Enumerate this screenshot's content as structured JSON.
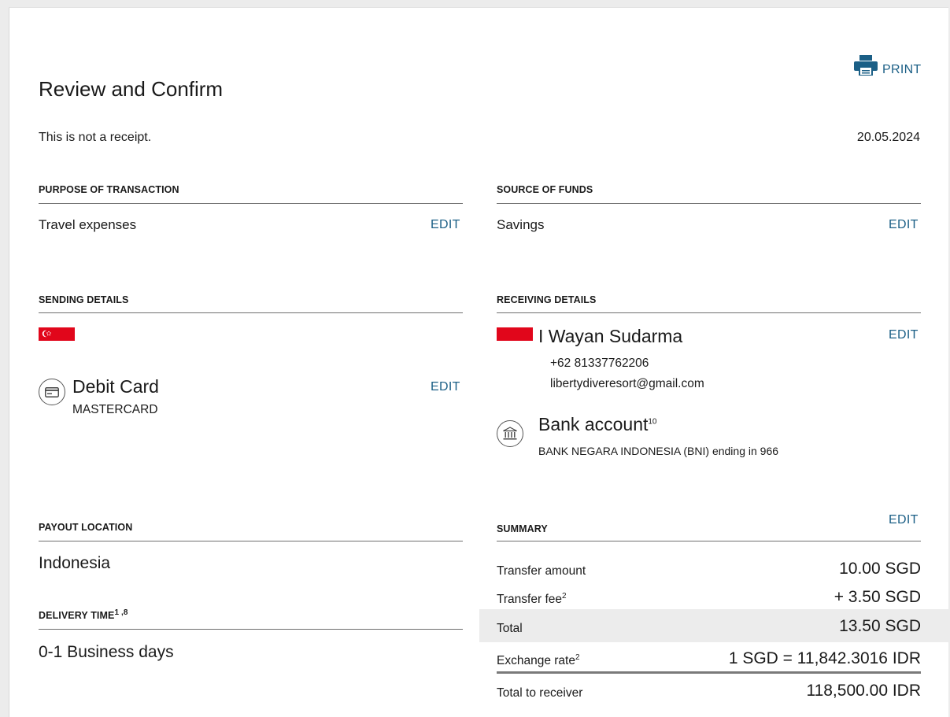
{
  "page": {
    "title": "Review and Confirm",
    "subtitle": "This is not a receipt.",
    "date": "20.05.2024",
    "print_label": "PRINT"
  },
  "purpose": {
    "heading": "PURPOSE OF TRANSACTION",
    "value": "Travel expenses",
    "edit_label": "EDIT"
  },
  "source": {
    "heading": "SOURCE OF FUNDS",
    "value": "Savings",
    "edit_label": "EDIT"
  },
  "sending": {
    "heading": "SENDING DETAILS",
    "flag": "singapore-flag-icon",
    "method": "Debit Card",
    "card_brand": "MASTERCARD",
    "edit_label": "EDIT"
  },
  "receiving": {
    "heading": "RECEIVING DETAILS",
    "flag": "indonesia-flag-icon",
    "name": "I Wayan Sudarma",
    "phone": "+62 81337762206",
    "email": "libertydiveresort@gmail.com",
    "edit_label": "EDIT",
    "account_type": "Bank account",
    "account_sup": "10",
    "account_detail": "BANK NEGARA INDONESIA (BNI) ending in 966"
  },
  "payout": {
    "heading": "PAYOUT LOCATION",
    "value": "Indonesia"
  },
  "delivery": {
    "heading": "DELIVERY TIME",
    "heading_sup": "1 ,8",
    "value": "0-1 Business days"
  },
  "summary": {
    "heading": "SUMMARY",
    "edit_label": "EDIT",
    "rows": [
      {
        "label": "Transfer amount",
        "sup": "",
        "value": "10.00 SGD"
      },
      {
        "label": "Transfer fee",
        "sup": "2",
        "value": "+ 3.50 SGD"
      },
      {
        "label": "Total",
        "sup": "",
        "value": "13.50 SGD"
      },
      {
        "label": "Exchange rate",
        "sup": "2",
        "value": "1 SGD = 11,842.3016 IDR"
      },
      {
        "label": "Total to receiver",
        "sup": "",
        "value": "118,500.00 IDR"
      }
    ]
  },
  "colors": {
    "accent": "#1b5f86",
    "flag_red": "#e1061b",
    "total_row_bg": "#ececec"
  }
}
